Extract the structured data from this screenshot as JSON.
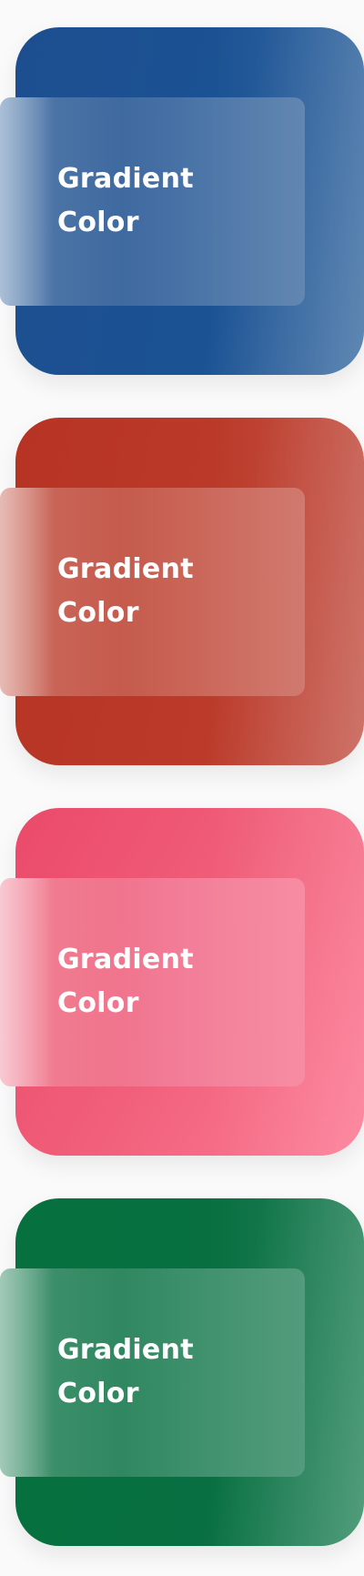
{
  "swatches": [
    {
      "id": "blue",
      "label_line1": "Gradient",
      "label_line2": "Color",
      "colors": {
        "start": "#1d4f90",
        "end": "#4a77a8"
      }
    },
    {
      "id": "red",
      "label_line1": "Gradient",
      "label_line2": "Color",
      "colors": {
        "start": "#b73425",
        "end": "#c76055"
      }
    },
    {
      "id": "pink",
      "label_line1": "Gradient",
      "label_line2": "Color",
      "colors": {
        "start": "#eb4a6a",
        "end": "#fc7b95"
      }
    },
    {
      "id": "green",
      "label_line1": "Gradient",
      "label_line2": "Color",
      "colors": {
        "start": "#06703e",
        "end": "#3a8f6a"
      }
    }
  ]
}
